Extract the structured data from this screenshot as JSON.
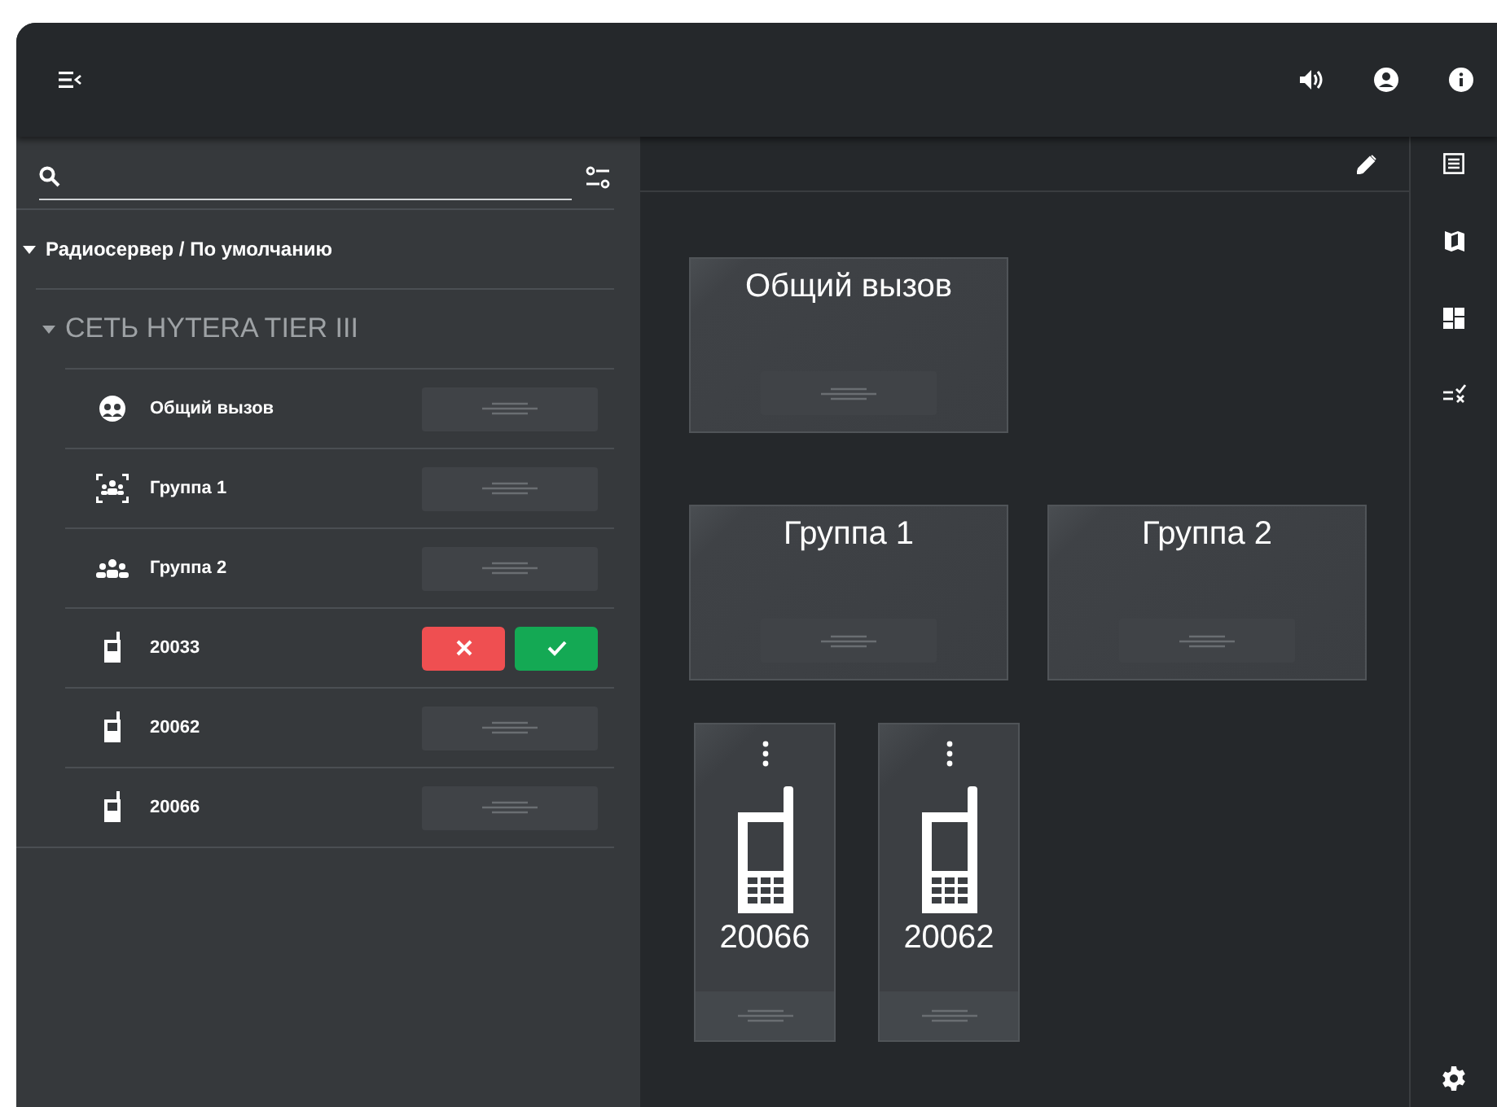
{
  "server": {
    "label": "Радиосервер / По умолчанию",
    "expanded": true
  },
  "network": {
    "label": "СЕТЬ HYTERA TIER III",
    "expanded": true
  },
  "items": [
    {
      "kind": "allcall",
      "label": "Общий вызов",
      "incoming": false
    },
    {
      "kind": "scan",
      "label": "Группа 1",
      "incoming": false
    },
    {
      "kind": "group",
      "label": "Группа 2",
      "incoming": false
    },
    {
      "kind": "radio",
      "label": "20033",
      "incoming": true
    },
    {
      "kind": "radio",
      "label": "20062",
      "incoming": false
    },
    {
      "kind": "radio",
      "label": "20066",
      "incoming": false
    }
  ],
  "tile_rows": [
    [
      {
        "kind": "group",
        "label": "Общий вызов"
      }
    ],
    [
      {
        "kind": "group",
        "label": "Группа 1"
      },
      {
        "kind": "group",
        "label": "Группа 2"
      }
    ],
    [
      {
        "kind": "radio",
        "label": "20066"
      },
      {
        "kind": "radio",
        "label": "20062"
      }
    ]
  ]
}
